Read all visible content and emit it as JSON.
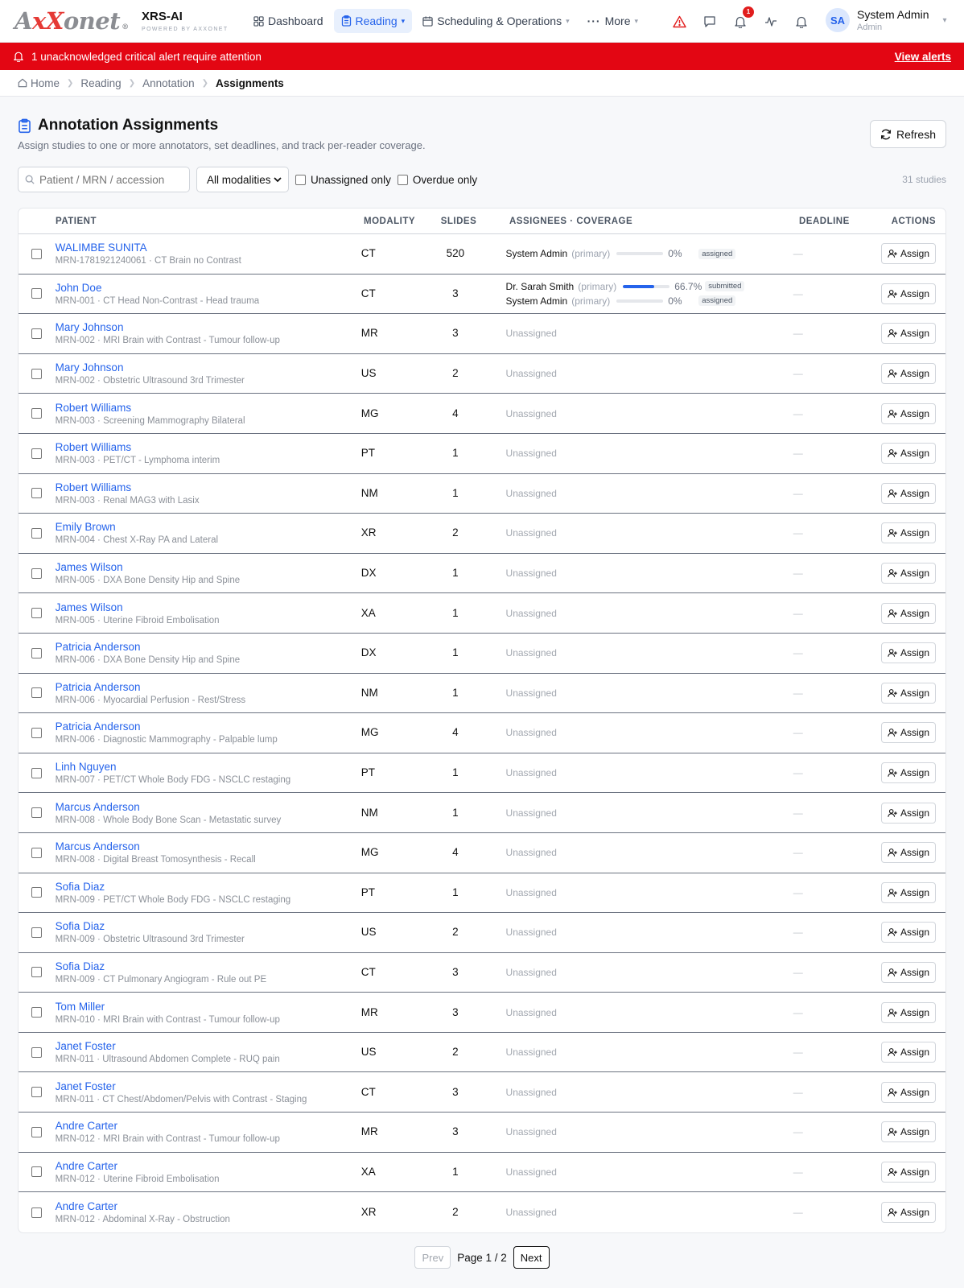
{
  "brand": {
    "logo_prefix": "A",
    "logo_x1": "x",
    "logo_x2": "X",
    "logo_suffix": "onet",
    "logo_reg": "®",
    "product": "XRS-AI",
    "product_sub": "POWERED BY AXXONET"
  },
  "nav": [
    {
      "label": "Dashboard",
      "icon": "grid-icon",
      "active": false,
      "dropdown": false
    },
    {
      "label": "Reading",
      "icon": "clipboard-icon",
      "active": true,
      "dropdown": true
    },
    {
      "label": "Scheduling & Operations",
      "icon": "calendar-icon",
      "active": false,
      "dropdown": true
    },
    {
      "label": "More",
      "icon": "ellipsis-icon",
      "active": false,
      "dropdown": true
    }
  ],
  "header_icons": {
    "notification_count": "1"
  },
  "user": {
    "initials": "SA",
    "name": "System Admin",
    "role": "Admin"
  },
  "alert": {
    "message": "1 unacknowledged critical alert require attention",
    "link": "View alerts",
    "color": "#e30613"
  },
  "breadcrumb": [
    "Home",
    "Reading",
    "Annotation",
    "Assignments"
  ],
  "page": {
    "title": "Annotation Assignments",
    "subtitle": "Assign studies to one or more annotators, set deadlines, and track per-reader coverage.",
    "refresh_label": "Refresh"
  },
  "filters": {
    "search_placeholder": "Patient / MRN / accession",
    "modality_selected": "All modalities",
    "unassigned_label": "Unassigned only",
    "overdue_label": "Overdue only",
    "count": "31 studies"
  },
  "table": {
    "headers": {
      "patient": "PATIENT",
      "modality": "MODALITY",
      "slides": "SLIDES",
      "assignees": "ASSIGNEES · COVERAGE",
      "deadline": "DEADLINE",
      "actions": "ACTIONS"
    },
    "unassigned_text": "Unassigned",
    "deadline_empty": "—",
    "assign_label": "Assign",
    "rows": [
      {
        "name": "WALIMBE SUNITA",
        "meta": "MRN-1781921240061 · CT Brain no Contrast",
        "modality": "CT",
        "slides": "520",
        "assignees": [
          {
            "name": "System Admin",
            "role": "(primary)",
            "pct_text": "0%",
            "pct": 0,
            "status": "assigned"
          }
        ]
      },
      {
        "name": "John Doe",
        "meta": "MRN-001 · CT Head Non-Contrast - Head trauma",
        "modality": "CT",
        "slides": "3",
        "assignees": [
          {
            "name": "Dr. Sarah Smith",
            "role": "(primary)",
            "pct_text": "66.7%",
            "pct": 66.7,
            "status": "submitted"
          },
          {
            "name": "System Admin",
            "role": "(primary)",
            "pct_text": "0%",
            "pct": 0,
            "status": "assigned"
          }
        ]
      },
      {
        "name": "Mary Johnson",
        "meta": "MRN-002 · MRI Brain with Contrast - Tumour follow-up",
        "modality": "MR",
        "slides": "3",
        "assignees": []
      },
      {
        "name": "Mary Johnson",
        "meta": "MRN-002 · Obstetric Ultrasound 3rd Trimester",
        "modality": "US",
        "slides": "2",
        "assignees": []
      },
      {
        "name": "Robert Williams",
        "meta": "MRN-003 · Screening Mammography Bilateral",
        "modality": "MG",
        "slides": "4",
        "assignees": []
      },
      {
        "name": "Robert Williams",
        "meta": "MRN-003 · PET/CT - Lymphoma interim",
        "modality": "PT",
        "slides": "1",
        "assignees": []
      },
      {
        "name": "Robert Williams",
        "meta": "MRN-003 · Renal MAG3 with Lasix",
        "modality": "NM",
        "slides": "1",
        "assignees": []
      },
      {
        "name": "Emily Brown",
        "meta": "MRN-004 · Chest X-Ray PA and Lateral",
        "modality": "XR",
        "slides": "2",
        "assignees": []
      },
      {
        "name": "James Wilson",
        "meta": "MRN-005 · DXA Bone Density Hip and Spine",
        "modality": "DX",
        "slides": "1",
        "assignees": []
      },
      {
        "name": "James Wilson",
        "meta": "MRN-005 · Uterine Fibroid Embolisation",
        "modality": "XA",
        "slides": "1",
        "assignees": []
      },
      {
        "name": "Patricia Anderson",
        "meta": "MRN-006 · DXA Bone Density Hip and Spine",
        "modality": "DX",
        "slides": "1",
        "assignees": []
      },
      {
        "name": "Patricia Anderson",
        "meta": "MRN-006 · Myocardial Perfusion - Rest/Stress",
        "modality": "NM",
        "slides": "1",
        "assignees": []
      },
      {
        "name": "Patricia Anderson",
        "meta": "MRN-006 · Diagnostic Mammography - Palpable lump",
        "modality": "MG",
        "slides": "4",
        "assignees": []
      },
      {
        "name": "Linh Nguyen",
        "meta": "MRN-007 · PET/CT Whole Body FDG - NSCLC restaging",
        "modality": "PT",
        "slides": "1",
        "assignees": []
      },
      {
        "name": "Marcus Anderson",
        "meta": "MRN-008 · Whole Body Bone Scan - Metastatic survey",
        "modality": "NM",
        "slides": "1",
        "assignees": []
      },
      {
        "name": "Marcus Anderson",
        "meta": "MRN-008 · Digital Breast Tomosynthesis - Recall",
        "modality": "MG",
        "slides": "4",
        "assignees": []
      },
      {
        "name": "Sofia Diaz",
        "meta": "MRN-009 · PET/CT Whole Body FDG - NSCLC restaging",
        "modality": "PT",
        "slides": "1",
        "assignees": []
      },
      {
        "name": "Sofia Diaz",
        "meta": "MRN-009 · Obstetric Ultrasound 3rd Trimester",
        "modality": "US",
        "slides": "2",
        "assignees": []
      },
      {
        "name": "Sofia Diaz",
        "meta": "MRN-009 · CT Pulmonary Angiogram - Rule out PE",
        "modality": "CT",
        "slides": "3",
        "assignees": []
      },
      {
        "name": "Tom Miller",
        "meta": "MRN-010 · MRI Brain with Contrast - Tumour follow-up",
        "modality": "MR",
        "slides": "3",
        "assignees": []
      },
      {
        "name": "Janet Foster",
        "meta": "MRN-011 · Ultrasound Abdomen Complete - RUQ pain",
        "modality": "US",
        "slides": "2",
        "assignees": []
      },
      {
        "name": "Janet Foster",
        "meta": "MRN-011 · CT Chest/Abdomen/Pelvis with Contrast - Staging",
        "modality": "CT",
        "slides": "3",
        "assignees": []
      },
      {
        "name": "Andre Carter",
        "meta": "MRN-012 · MRI Brain with Contrast - Tumour follow-up",
        "modality": "MR",
        "slides": "3",
        "assignees": []
      },
      {
        "name": "Andre Carter",
        "meta": "MRN-012 · Uterine Fibroid Embolisation",
        "modality": "XA",
        "slides": "1",
        "assignees": []
      },
      {
        "name": "Andre Carter",
        "meta": "MRN-012 · Abdominal X-Ray - Obstruction",
        "modality": "XR",
        "slides": "2",
        "assignees": []
      }
    ]
  },
  "pagination": {
    "prev": "Prev",
    "page_text": "Page 1 / 2",
    "next": "Next"
  },
  "colors": {
    "accent": "#2563eb",
    "alert": "#e30613"
  }
}
